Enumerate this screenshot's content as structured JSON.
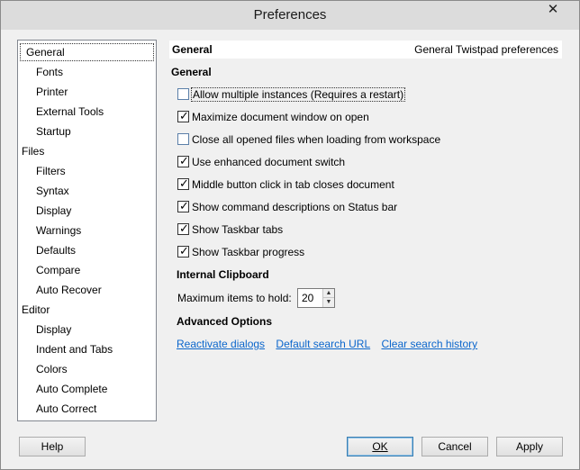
{
  "window": {
    "title": "Preferences",
    "close_glyph": "✕"
  },
  "tree": {
    "items": [
      {
        "label": "General",
        "level": 0,
        "selected": true
      },
      {
        "label": "Fonts",
        "level": 1
      },
      {
        "label": "Printer",
        "level": 1
      },
      {
        "label": "External Tools",
        "level": 1
      },
      {
        "label": "Startup",
        "level": 1
      },
      {
        "label": "Files",
        "level": 0
      },
      {
        "label": "Filters",
        "level": 1
      },
      {
        "label": "Syntax",
        "level": 1
      },
      {
        "label": "Display",
        "level": 1
      },
      {
        "label": "Warnings",
        "level": 1
      },
      {
        "label": "Defaults",
        "level": 1
      },
      {
        "label": "Compare",
        "level": 1
      },
      {
        "label": "Auto Recover",
        "level": 1
      },
      {
        "label": "Editor",
        "level": 0
      },
      {
        "label": "Display",
        "level": 1
      },
      {
        "label": "Indent and Tabs",
        "level": 1
      },
      {
        "label": "Colors",
        "level": 1
      },
      {
        "label": "Auto Complete",
        "level": 1
      },
      {
        "label": "Auto Correct",
        "level": 1
      }
    ]
  },
  "header": {
    "title": "General",
    "description": "General Twistpad preferences"
  },
  "general": {
    "section_title": "General",
    "options": [
      {
        "label": "Allow multiple instances (Requires a restart)",
        "checked": false,
        "focused": true
      },
      {
        "label": "Maximize document window on open",
        "checked": true
      },
      {
        "label": "Close all opened files when loading from workspace",
        "checked": false
      },
      {
        "label": "Use enhanced document switch",
        "checked": true
      },
      {
        "label": "Middle button click in tab closes document",
        "checked": true
      },
      {
        "label": "Show command descriptions on Status bar",
        "checked": true
      },
      {
        "label": "Show Taskbar tabs",
        "checked": true
      },
      {
        "label": "Show Taskbar progress",
        "checked": true
      }
    ]
  },
  "clipboard": {
    "section_title": "Internal Clipboard",
    "max_items_label": "Maximum items to hold:",
    "max_items_value": "20"
  },
  "advanced": {
    "section_title": "Advanced Options",
    "links": [
      "Reactivate dialogs",
      "Default search URL",
      "Clear search history"
    ]
  },
  "buttons": {
    "help": "Help",
    "ok": "OK",
    "cancel": "Cancel",
    "apply": "Apply"
  }
}
